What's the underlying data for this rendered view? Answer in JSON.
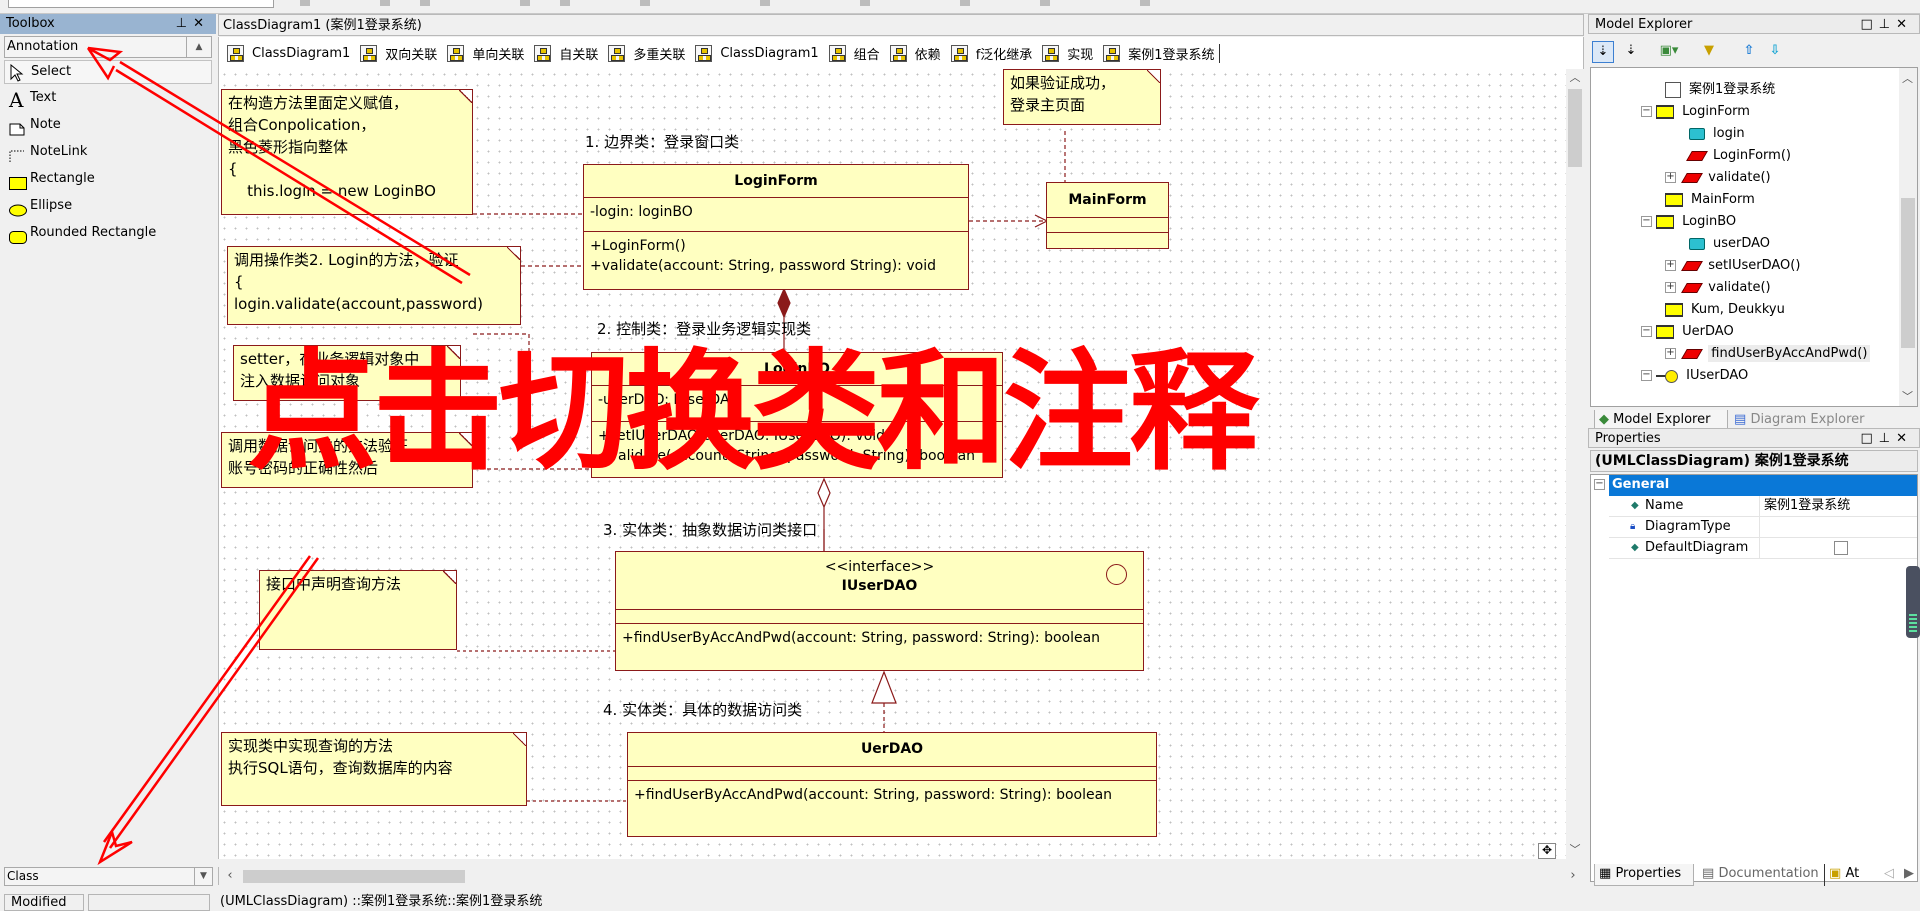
{
  "toolbox": {
    "title": "Toolbox",
    "category": "Annotation",
    "items": [
      {
        "label": "Select",
        "icon": "cursor-icon"
      },
      {
        "label": "Text",
        "icon": "text-icon"
      },
      {
        "label": "Note",
        "icon": "note-icon"
      },
      {
        "label": "NoteLink",
        "icon": "notelink-icon"
      },
      {
        "label": "Rectangle",
        "icon": "rectangle-icon"
      },
      {
        "label": "Ellipse",
        "icon": "ellipse-icon"
      },
      {
        "label": "Rounded Rectangle",
        "icon": "rounded-rectangle-icon"
      }
    ],
    "bottom_category": "Class"
  },
  "diagram": {
    "title": "ClassDiagram1 (案例1登录系统)",
    "tabs": [
      "ClassDiagram1",
      "双向关联",
      "单向关联",
      "自关联",
      "多重关联",
      "ClassDiagram1",
      "组合",
      "依赖",
      "f泛化继承",
      "实现",
      "案例1登录系统"
    ],
    "active_tab": "案例1登录系统",
    "labels": {
      "boundary": "1. 边界类：登录窗口类",
      "control": "2. 控制类：登录业务逻辑实现类",
      "entity_interface": "3. 实体类：抽象数据访问类接口",
      "entity_impl": "4. 实体类：具体的数据访问类"
    },
    "notes": {
      "ctor": "在构造方法里面定义赋值，\n组合Conpolication，\n黑色菱形指向整体\n{\n    this.login = new LoginBO",
      "validate": "调用操作类2. Login的方法，验证\n{\nlogin.validate(account,password)",
      "setter": "setter，在业务逻辑对象中\n注入数据访问对象",
      "dao_call": "调用数据访问类的方法验证\n账号密码的正确性然后",
      "success": "如果验证成功，\n登录主页面",
      "iface": "接口中声明查询方法",
      "impl": "实现类中实现查询的方法\n执行SQL语句，查询数据库的内容"
    },
    "classes": {
      "loginform": {
        "name": "LoginForm",
        "attrs": "-login: loginBO",
        "ops": "+LoginForm()\n+validate(account: String, password String): void"
      },
      "mainform": {
        "name": "MainForm"
      },
      "loginbo": {
        "name": "LoginBO",
        "attrs": "-userDAO: IUserDAO",
        "ops": "+setIUserDAO(userDAO: IUserDAO): void\n+validate(account: String, password: String): boolean"
      },
      "iuserdao": {
        "stereotype": "<<interface>>",
        "name": "IUserDAO",
        "ops": "+findUserByAccAndPwd(account: String, password: String): boolean"
      },
      "uerdao": {
        "name": "UerDAO",
        "ops": "+findUserByAccAndPwd(account: String, password: String): boolean"
      }
    },
    "overlay_text": "点击切换类和注释",
    "overlay_color": "#ff0000"
  },
  "model_explorer": {
    "title": "Model Explorer",
    "tree": [
      {
        "label": "案例1登录系统",
        "type": "diagram"
      },
      {
        "label": "LoginForm",
        "type": "class",
        "expanded": true
      },
      {
        "label": "login",
        "type": "attribute"
      },
      {
        "label": "LoginForm()",
        "type": "operation"
      },
      {
        "label": "validate()",
        "type": "operation",
        "collapsed": true
      },
      {
        "label": "MainForm",
        "type": "class"
      },
      {
        "label": "LoginBO",
        "type": "class",
        "expanded": true
      },
      {
        "label": "userDAO",
        "type": "attribute"
      },
      {
        "label": "setIUserDAO()",
        "type": "operation",
        "collapsed": true
      },
      {
        "label": "validate()",
        "type": "operation",
        "collapsed": true
      },
      {
        "label": "Kum, Deukkyu",
        "type": "class"
      },
      {
        "label": "UerDAO",
        "type": "class",
        "expanded": true
      },
      {
        "label": "findUserByAccAndPwd()",
        "type": "operation",
        "collapsed": true,
        "selected": true
      },
      {
        "label": "IUserDAO",
        "type": "interface",
        "expanded": true
      }
    ],
    "tabs": [
      "Model Explorer",
      "Diagram Explorer"
    ]
  },
  "properties": {
    "title": "Properties",
    "header": "(UMLClassDiagram) 案例1登录系统",
    "group": "General",
    "rows": [
      {
        "key": "Name",
        "value": "案例1登录系统"
      },
      {
        "key": "DiagramType",
        "value": ""
      },
      {
        "key": "DefaultDiagram",
        "value": "",
        "checkbox": true,
        "checked": false
      }
    ],
    "tabs": [
      "Properties",
      "Documentation",
      "At"
    ]
  },
  "statusbar": {
    "state": "Modified",
    "path": "(UMLClassDiagram) ::案例1登录系统::案例1登录系统"
  }
}
